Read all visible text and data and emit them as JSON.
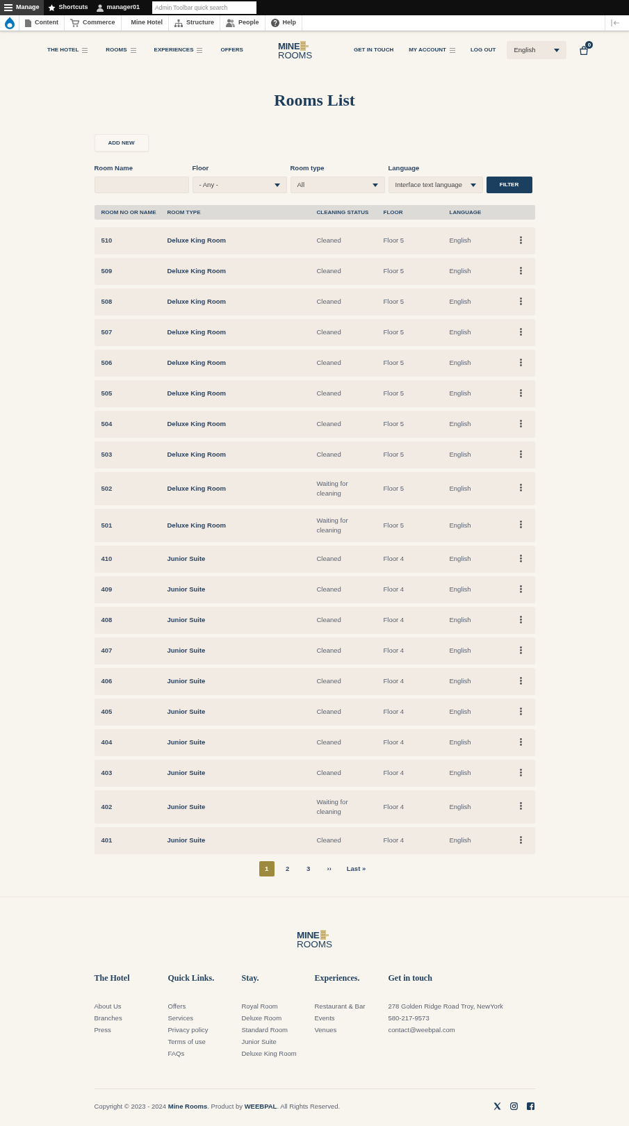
{
  "admin_toolbar": {
    "items": [
      {
        "label": "Manage",
        "selected": true
      },
      {
        "label": "Shortcuts",
        "selected": false
      },
      {
        "label": "manager01",
        "selected": false
      }
    ],
    "search": {
      "placeholder": "Admin Toolbar quick search"
    }
  },
  "admin_menu": {
    "items": [
      {
        "label": "Content"
      },
      {
        "label": "Commerce"
      },
      {
        "label": "Mine Hotel"
      },
      {
        "label": "Structure"
      },
      {
        "label": "People"
      },
      {
        "label": "Help"
      }
    ]
  },
  "nav": {
    "left": [
      {
        "label": "THE HOTEL",
        "has_submenu": true
      },
      {
        "label": "ROOMS",
        "has_submenu": true
      },
      {
        "label": "EXPERIENCES",
        "has_submenu": true
      },
      {
        "label": "OFFERS",
        "has_submenu": false
      }
    ],
    "logo": {
      "line_1": "MINE",
      "line_2": "ROOMS"
    },
    "right": [
      {
        "label": "GET IN TOUCH",
        "has_submenu": false
      },
      {
        "label": "MY ACCOUNT",
        "has_submenu": true
      },
      {
        "label": "LOG OUT",
        "has_submenu": false
      }
    ],
    "language_select": {
      "value": "English"
    },
    "cart": {
      "count": "0"
    }
  },
  "page_title": "Rooms List",
  "add_button": "ADD NEW",
  "filters": [
    {
      "label": "Room Name",
      "kind": "text"
    },
    {
      "label": "Floor",
      "kind": "select",
      "value": "- Any -"
    },
    {
      "label": "Room type",
      "kind": "select",
      "value": "All"
    },
    {
      "label": "Language",
      "kind": "select",
      "value": "Interface text language"
    }
  ],
  "filter_button": "FILTER",
  "table": {
    "columns": [
      "ROOM NO OR NAME",
      "ROOM TYPE",
      "CLEANING STATUS",
      "FLOOR",
      "LANGUAGE"
    ],
    "rows": [
      {
        "room": "510",
        "room_type": "Deluxe King Room",
        "cleaning_status": "Cleaned",
        "floor": "Floor 5",
        "language": "English"
      },
      {
        "room": "509",
        "room_type": "Deluxe King Room",
        "cleaning_status": "Cleaned",
        "floor": "Floor 5",
        "language": "English"
      },
      {
        "room": "508",
        "room_type": "Deluxe King Room",
        "cleaning_status": "Cleaned",
        "floor": "Floor 5",
        "language": "English"
      },
      {
        "room": "507",
        "room_type": "Deluxe King Room",
        "cleaning_status": "Cleaned",
        "floor": "Floor 5",
        "language": "English"
      },
      {
        "room": "506",
        "room_type": "Deluxe King Room",
        "cleaning_status": "Cleaned",
        "floor": "Floor 5",
        "language": "English"
      },
      {
        "room": "505",
        "room_type": "Deluxe King Room",
        "cleaning_status": "Cleaned",
        "floor": "Floor 5",
        "language": "English"
      },
      {
        "room": "504",
        "room_type": "Deluxe King Room",
        "cleaning_status": "Cleaned",
        "floor": "Floor 5",
        "language": "English"
      },
      {
        "room": "503",
        "room_type": "Deluxe King Room",
        "cleaning_status": "Cleaned",
        "floor": "Floor 5",
        "language": "English"
      },
      {
        "room": "502",
        "room_type": "Deluxe King Room",
        "cleaning_status": "Waiting for cleaning",
        "floor": "Floor 5",
        "language": "English"
      },
      {
        "room": "501",
        "room_type": "Deluxe King Room",
        "cleaning_status": "Waiting for cleaning",
        "floor": "Floor 5",
        "language": "English"
      },
      {
        "room": "410",
        "room_type": "Junior Suite",
        "cleaning_status": "Cleaned",
        "floor": "Floor 4",
        "language": "English"
      },
      {
        "room": "409",
        "room_type": "Junior Suite",
        "cleaning_status": "Cleaned",
        "floor": "Floor 4",
        "language": "English"
      },
      {
        "room": "408",
        "room_type": "Junior Suite",
        "cleaning_status": "Cleaned",
        "floor": "Floor 4",
        "language": "English"
      },
      {
        "room": "407",
        "room_type": "Junior Suite",
        "cleaning_status": "Cleaned",
        "floor": "Floor 4",
        "language": "English"
      },
      {
        "room": "406",
        "room_type": "Junior Suite",
        "cleaning_status": "Cleaned",
        "floor": "Floor 4",
        "language": "English"
      },
      {
        "room": "405",
        "room_type": "Junior Suite",
        "cleaning_status": "Cleaned",
        "floor": "Floor 4",
        "language": "English"
      },
      {
        "room": "404",
        "room_type": "Junior Suite",
        "cleaning_status": "Cleaned",
        "floor": "Floor 4",
        "language": "English"
      },
      {
        "room": "403",
        "room_type": "Junior Suite",
        "cleaning_status": "Cleaned",
        "floor": "Floor 4",
        "language": "English"
      },
      {
        "room": "402",
        "room_type": "Junior Suite",
        "cleaning_status": "Waiting for cleaning",
        "floor": "Floor 4",
        "language": "English"
      },
      {
        "room": "401",
        "room_type": "Junior Suite",
        "cleaning_status": "Cleaned",
        "floor": "Floor 4",
        "language": "English"
      }
    ]
  },
  "pagination": {
    "pages": [
      {
        "label": "1",
        "selected": true
      },
      {
        "label": "2",
        "selected": false
      },
      {
        "label": "3",
        "selected": false
      }
    ],
    "next": "››",
    "last": "Last »"
  },
  "footer": {
    "logo": {
      "line_1": "MINE",
      "line_2": "ROOMS"
    },
    "columns": [
      {
        "title": "The Hotel",
        "links": [
          "About Us",
          "Branches",
          "Press"
        ]
      },
      {
        "title": "Quick Links.",
        "links": [
          "Offers",
          "Services",
          "Privacy policy",
          "Terms of use",
          "FAQs"
        ]
      },
      {
        "title": "Stay.",
        "links": [
          "Royal Room",
          "Deluxe Room",
          "Standard Room",
          "Junior Suite",
          "Deluxe King Room"
        ]
      },
      {
        "title": "Experiences.",
        "links": [
          "Restaurant & Bar",
          "Events",
          "Venues"
        ]
      },
      {
        "title": "Get in touch",
        "links": [
          "278 Golden Ridge Road Troy, NewYork",
          "580-217-9573",
          "contact@weebpal.com"
        ]
      }
    ],
    "copyright": "Copyright © 2023 - 2024 **Mine Rooms**. Product by **WEEBPAL**. All Rights Reserved."
  }
}
